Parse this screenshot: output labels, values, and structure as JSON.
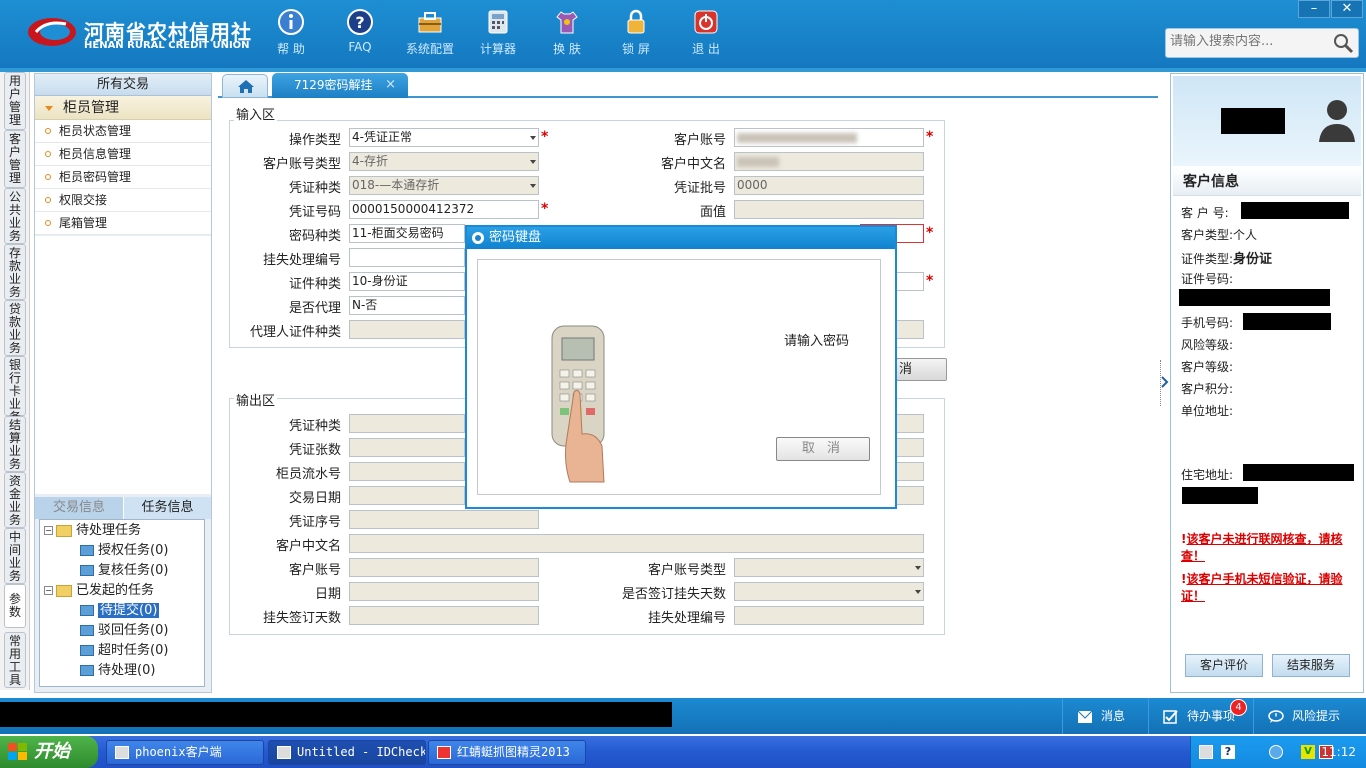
{
  "app": {
    "logo_cn": "河南省农村信用社",
    "logo_en": "HENAN RURAL CREDIT UNION"
  },
  "toolbar": [
    {
      "label": "帮 助",
      "icon": "info-icon"
    },
    {
      "label": "FAQ",
      "icon": "question-icon"
    },
    {
      "label": "系统配置",
      "icon": "toolbox-icon"
    },
    {
      "label": "计算器",
      "icon": "calculator-icon"
    },
    {
      "label": "换 肤",
      "icon": "shirt-icon"
    },
    {
      "label": "锁 屏",
      "icon": "lock-icon"
    },
    {
      "label": "退 出",
      "icon": "power-icon"
    }
  ],
  "window": {
    "minimize": "–",
    "close": "✕"
  },
  "search": {
    "placeholder": "请输入搜索内容..."
  },
  "vtabs": [
    "用户管理",
    "客户管理",
    "公共业务",
    "存款业务",
    "贷款业务",
    "银行卡业务",
    "结算业务",
    "资金业务",
    "中间业务",
    "参数",
    "常用工具"
  ],
  "left": {
    "header": "所有交易",
    "group": "柜员管理",
    "items": [
      "柜员状态管理",
      "柜员信息管理",
      "柜员密码管理",
      "权限交接",
      "尾箱管理"
    ],
    "tabs": [
      "交易信息",
      "任务信息"
    ],
    "tree": {
      "pending": "待处理任务",
      "auth": "授权任务(0)",
      "review": "复核任务(0)",
      "initiated": "已发起的任务",
      "submit": "待提交(0)",
      "rejected": "驳回任务(0)",
      "timeout": "超时任务(0)",
      "todo": "待处理(0)"
    }
  },
  "tabs": {
    "active": "7129密码解挂",
    "close": "×"
  },
  "input": {
    "title": "输入区",
    "op_type_label": "操作类型",
    "op_type": "4-凭证正常",
    "acct_type_label": "客户账号类型",
    "acct_type": "4-存折",
    "voucher_kind_label": "凭证种类",
    "voucher_kind": "018-—本通存折",
    "voucher_no_label": "凭证号码",
    "voucher_no": "0000150000412372",
    "pwd_kind_label": "密码种类",
    "pwd_kind": "11-柜面交易密码",
    "loss_no_label": "挂失处理编号",
    "id_kind_label": "证件种类",
    "id_kind": "10-身份证",
    "agent_label": "是否代理",
    "agent": "N-否",
    "agent_id_label": "代理人证件种类",
    "cust_acct_label": "客户账号",
    "cust_name_label": "客户中文名",
    "batch_label": "凭证批号",
    "batch": "0000",
    "face_label": "面值"
  },
  "cancel_main": "消",
  "output": {
    "title": "输出区",
    "labels": [
      "凭证种类",
      "凭证张数",
      "柜员流水号",
      "交易日期",
      "凭证序号",
      "客户中文名",
      "客户账号",
      "日期",
      "挂失签订天数"
    ],
    "right_labels": [
      "客户账号类型",
      "是否签订挂失天数",
      "挂失处理编号"
    ]
  },
  "dialog": {
    "title": "密码键盘",
    "message": "请输入密码",
    "cancel": "取 消"
  },
  "customer": {
    "title": "客户信息",
    "cust_no_label": "客 户 号:",
    "cust_type_label": "客户类型:",
    "cust_type": "个人",
    "id_type_label": "证件类型:",
    "id_type": "身份证",
    "id_no_label": "证件号码:",
    "phone_label": "手机号码:",
    "risk_label": "风险等级:",
    "level_label": "客户等级:",
    "points_label": "客户积分:",
    "company_label": "单位地址:",
    "home_label": "住宅地址:",
    "warn1": "该客户未进行联网核查，请核查！",
    "warn2": "该客户手机未短信验证，请验证！",
    "btn_eval": "客户评价",
    "btn_end": "结束服务"
  },
  "status": {
    "msg": "消息",
    "todo": "待办事项",
    "badge": "4",
    "risk": "风险提示"
  },
  "taskbar": {
    "start": "开始",
    "tasks": [
      "phoenix客户端",
      "Untitled - IDCheck",
      "红蜻蜓抓图精灵2013"
    ],
    "clock": "11:12"
  }
}
